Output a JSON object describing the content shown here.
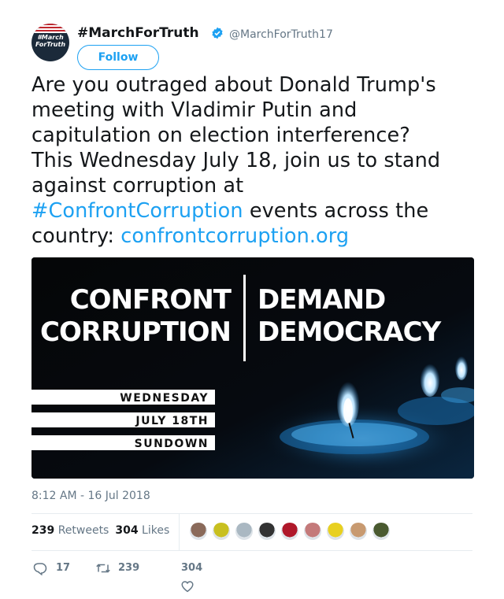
{
  "author": {
    "name": "#MarchForTruth",
    "handle": "@MarchForTruth17",
    "avatar_text": [
      "#March",
      "ForTruth"
    ],
    "verified_icon": "verified-badge-icon",
    "follow_label": "Follow"
  },
  "tweet": {
    "line1": "Are you outraged about Donald Trump's",
    "line2": "meeting with Vladimir Putin and",
    "line3": "capitulation on election interference?",
    "line4": "This Wednesday July 18, join us to stand",
    "line5": "against corruption at",
    "hashtag": "#ConfrontCorruption",
    "line6_rest": " events across the",
    "line7_start": "country: ",
    "url": "confrontcorruption.org"
  },
  "media": {
    "left_title": [
      "CONFRONT",
      "CORRUPTION"
    ],
    "right_title": [
      "DEMAND",
      "DEMOCRACY"
    ],
    "details": [
      "WEDNESDAY",
      "JULY 18TH",
      "SUNDOWN"
    ]
  },
  "meta": {
    "timestamp": "8:12 AM - 16 Jul 2018",
    "retweets_count": "239",
    "retweets_label": "Retweets",
    "likes_count": "304",
    "likes_label": "Likes"
  },
  "likers": [
    {
      "name": "liker-avatar-1",
      "color": "#8a6a5a"
    },
    {
      "name": "liker-avatar-2",
      "color": "#c8c020"
    },
    {
      "name": "liker-avatar-3",
      "color": "#aab8c2"
    },
    {
      "name": "liker-avatar-4",
      "color": "#333333"
    },
    {
      "name": "liker-avatar-5",
      "color": "#b0182a"
    },
    {
      "name": "liker-avatar-6",
      "color": "#c47a7a"
    },
    {
      "name": "liker-avatar-7",
      "color": "#e8d020"
    },
    {
      "name": "liker-avatar-8",
      "color": "#c89a70"
    },
    {
      "name": "liker-avatar-9",
      "color": "#4a5a30"
    }
  ],
  "actions": {
    "reply_count": "17",
    "retweet_count": "239",
    "like_count": "304"
  },
  "colors": {
    "accent": "#1da1f2",
    "text": "#14171a",
    "muted": "#657786"
  }
}
